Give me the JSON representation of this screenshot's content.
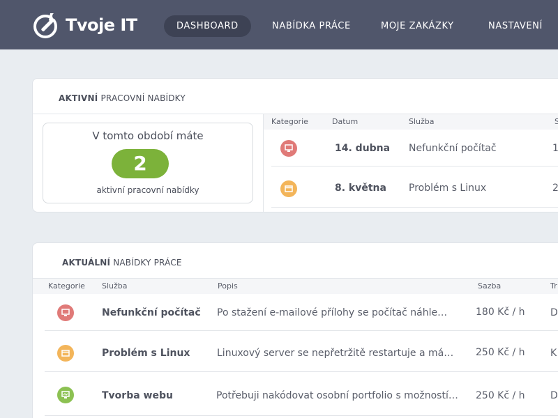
{
  "brand": {
    "name": "Tvoje IT",
    "logo_icon": "wrench-gear-icon"
  },
  "nav": [
    {
      "label": "DASHBOARD",
      "active": true
    },
    {
      "label": "NABÍDKA PRÁCE",
      "active": false
    },
    {
      "label": "MOJE ZAKÁZKY",
      "active": false
    },
    {
      "label": "NASTAVENÍ",
      "active": false
    }
  ],
  "active_offers": {
    "title_bold": "AKTIVNÍ",
    "title_rest": " PRACOVNÍ NABÍDKY",
    "summary": {
      "line1": "V tomto období máte",
      "count": "2",
      "line2": "aktivní pracovní nabídky"
    },
    "columns": [
      "Kategorie",
      "Datum",
      "Služba",
      "S"
    ],
    "rows": [
      {
        "icon": "computer-icon",
        "color": "#e07a78",
        "date": "14. dubna",
        "service": "Nefunkční počítač",
        "extra": "1"
      },
      {
        "icon": "window-icon",
        "color": "#f3b55a",
        "date": "8. května",
        "service": "Problém s Linux",
        "extra": "2"
      }
    ]
  },
  "current_offers": {
    "title_bold": "AKTUÁLNÍ",
    "title_rest": " NABÍDKY PRÁCE",
    "columns": [
      "Kategorie",
      "Služba",
      "Popis",
      "Sazba",
      "Tr"
    ],
    "rows": [
      {
        "icon": "computer-icon",
        "color": "#e07a78",
        "service": "Nefunkční počítač",
        "description": "Po stažení e-mailové přílohy se počítač náhle…",
        "rate": "180 Kč / h",
        "extra": "D"
      },
      {
        "icon": "window-icon",
        "color": "#f3b55a",
        "service": "Problém s Linux",
        "description": "Linuxový server se nepřetržitě restartuje a má…",
        "rate": "250 Kč / h",
        "extra": "K"
      },
      {
        "icon": "monitor-icon",
        "color": "#8cc152",
        "service": "Tvorba webu",
        "description": "Potřebuji nakódovat osobní portfolio s možností…",
        "rate": "250 Kč / h",
        "extra": "D"
      }
    ]
  },
  "colors": {
    "navbar": "#50566b",
    "accent_green": "#7cb23a",
    "background": "#e9edf1"
  }
}
